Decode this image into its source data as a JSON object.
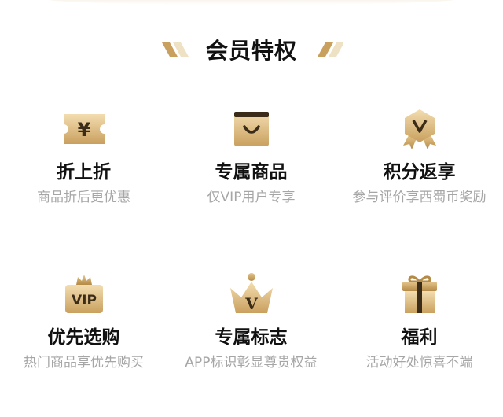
{
  "header": {
    "title": "会员特权"
  },
  "colors": {
    "gold_light": "#f3ddb0",
    "gold": "#d2ab6a",
    "gold_dark": "#b38a46",
    "ink": "#3a2c18",
    "title": "#111111",
    "desc": "#a6a6a6"
  },
  "privileges": [
    {
      "icon": "yuan-ticket-icon",
      "glyph": "¥",
      "title": "折上折",
      "desc": "商品折后更优惠"
    },
    {
      "icon": "shopping-bag-icon",
      "title": "专属商品",
      "desc": "仅VIP用户专享"
    },
    {
      "icon": "badge-v-icon",
      "glyph": "V",
      "title": "积分返享",
      "desc": "参与评价享西蜀币奖励"
    },
    {
      "icon": "vip-crown-tag-icon",
      "glyph": "VIP",
      "title": "优先选购",
      "desc": "热门商品享优先购买"
    },
    {
      "icon": "crown-v-icon",
      "glyph": "V",
      "title": "专属标志",
      "desc": "APP标识彰显尊贵权益"
    },
    {
      "icon": "gift-box-icon",
      "title": "福利",
      "desc": "活动好处惊喜不端"
    }
  ]
}
